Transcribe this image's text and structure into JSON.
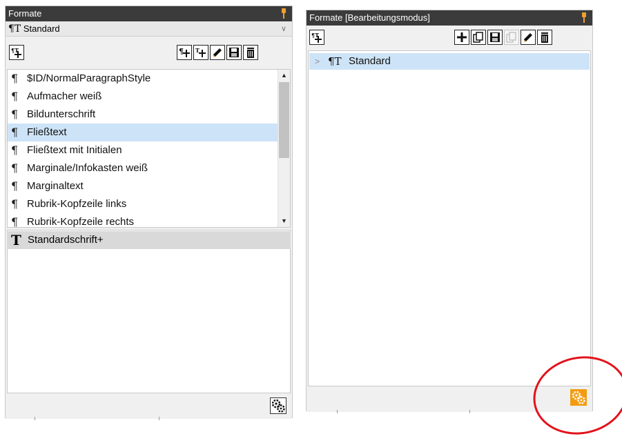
{
  "left_panel": {
    "title": "Formate",
    "dropdown": {
      "glyph": "¶T",
      "selected": "Standard"
    },
    "paragraph_styles": [
      "$ID/NormalParagraphStyle",
      "Aufmacher weiß",
      "Bildunterschrift",
      "Fließtext",
      "Fließtext mit Initialen",
      "Marginale/Infokasten weiß",
      "Marginaltext",
      "Rubrik-Kopfzeile links",
      "Rubrik-Kopfzeile rechts"
    ],
    "selected_style": "Fließtext",
    "paragraph_glyph": "¶",
    "character_style": {
      "glyph": "T",
      "label": "Standardschrift+"
    }
  },
  "right_panel": {
    "title": "Formate [Bearbeitungsmodus]",
    "tree": [
      {
        "expander": ">",
        "glyph": "¶T",
        "label": "Standard"
      }
    ]
  },
  "colors": {
    "titlebar": "#3b3b3b",
    "pin": "#f0a030",
    "selection": "#cde3f7",
    "annotation": "#e3121b",
    "gear_active": "#f39c12"
  },
  "icons": [
    "pin-icon",
    "new-style-group-icon",
    "new-paragraph-style-icon",
    "new-character-style-icon",
    "edit-pencil-icon",
    "save-icon",
    "trash-icon",
    "plus-icon",
    "copy-icon",
    "gears-icon"
  ]
}
